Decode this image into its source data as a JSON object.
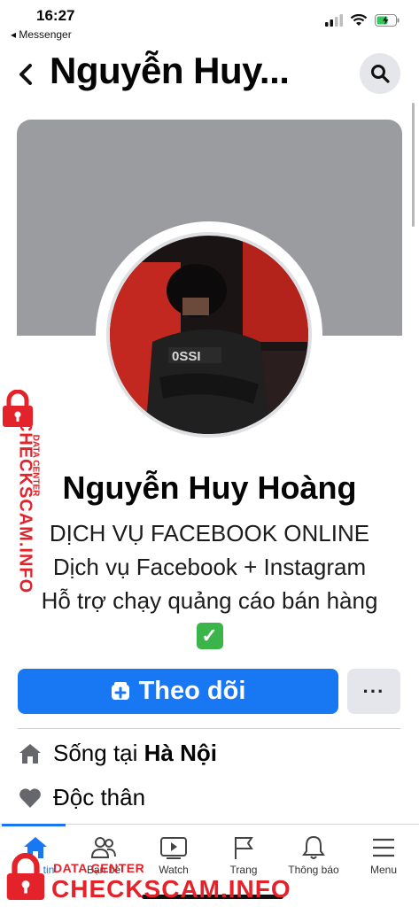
{
  "status_bar": {
    "time": "16:27",
    "back_app": "◂ Messenger"
  },
  "header": {
    "title": "Nguyễn Huy...",
    "back_icon": "chevron-left-icon",
    "search_icon": "search-icon"
  },
  "profile": {
    "name": "Nguyễn Huy Hoàng",
    "bio_lines": [
      "DỊCH VỤ FACEBOOK ONLINE",
      "Dịch vụ Facebook + Instagram",
      "Hỗ trợ chạy quảng cáo bán hàng"
    ],
    "bio_emoji": "✅"
  },
  "actions": {
    "follow_label": "Theo dõi",
    "more_label": "···"
  },
  "info": {
    "lives_prefix": "Sống tại ",
    "lives_city": "Hà Nội",
    "relationship": "Độc thân"
  },
  "tabs": [
    {
      "label": "tin",
      "icon": "home-icon",
      "active": true
    },
    {
      "label": "Bạn bè",
      "icon": "friends-icon"
    },
    {
      "label": "Watch",
      "icon": "watch-icon"
    },
    {
      "label": "Trang",
      "icon": "flag-icon"
    },
    {
      "label": "Thông báo",
      "icon": "bell-icon"
    },
    {
      "label": "Menu",
      "icon": "menu-icon"
    }
  ],
  "watermark": {
    "brand": "CHECKSCAM.INFO",
    "sub": "DATA CENTER"
  },
  "colors": {
    "accent": "#1877f2",
    "cover": "#9b9ca0",
    "watermark": "#e4222a"
  }
}
